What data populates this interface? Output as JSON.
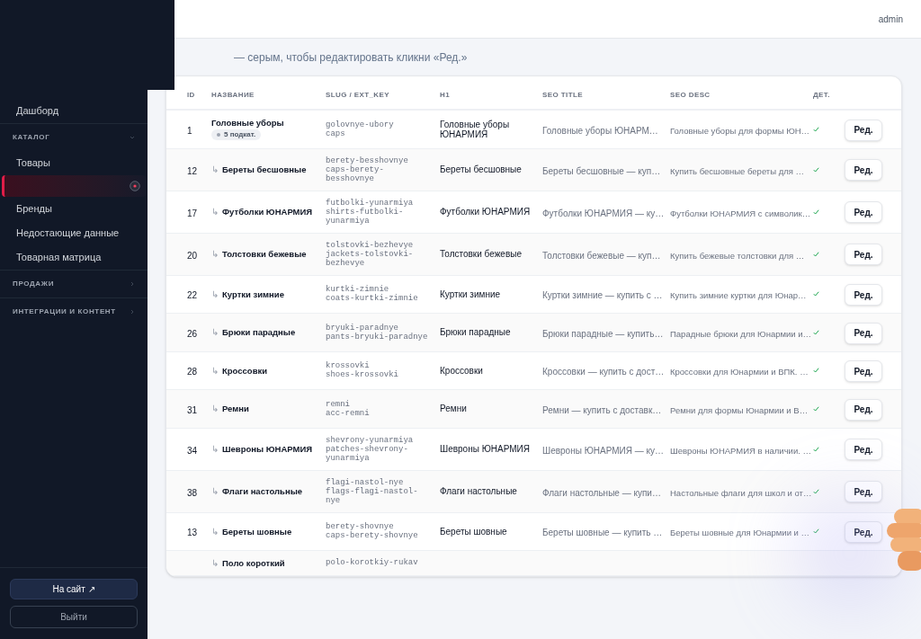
{
  "sidebar": {
    "items": [
      {
        "kind": "link",
        "label": "Дашборд",
        "selected": false
      },
      {
        "kind": "section",
        "label": "КАТАЛОГ",
        "expanded": true
      },
      {
        "kind": "link",
        "label": "Товары",
        "selected": false
      },
      {
        "kind": "link",
        "selected": true
      },
      {
        "kind": "link",
        "label": "Бренды",
        "selected": false
      },
      {
        "kind": "link",
        "label": "Недостающие данные",
        "selected": false
      },
      {
        "kind": "link",
        "label": "Товарная матрица",
        "selected": false
      },
      {
        "kind": "section",
        "label": "ПРОДАЖИ",
        "expanded": false
      },
      {
        "kind": "section",
        "label": "ИНТЕГРАЦИИ И КОНТЕНТ",
        "expanded": false
      }
    ],
    "buttons": [
      {
        "kind": "primary",
        "label": "На сайт ↗"
      },
      {
        "kind": "outline",
        "label": "Выйти"
      }
    ]
  },
  "header": {
    "user": "admin"
  },
  "notice": "— серым, чтобы редактировать кликни «Ред.»",
  "table": {
    "columns": [
      "ID",
      "НАЗВАНИЕ",
      "SLUG / EXT_KEY",
      "H1",
      "SEO TITLE",
      "SEO DESC",
      "ДЕТ."
    ],
    "rows": [
      {
        "id": "1",
        "name": "Головные уборы",
        "badge": "5 подкат.",
        "slug": "golovnye-ubory",
        "ext_key": "caps",
        "h1": "Головные уборы ЮНАРМИЯ",
        "seo_title": "Головные уборы ЮНАРМ…",
        "seo_desc": "Головные уборы для формы ЮН…",
        "details": true,
        "action": "Ред."
      },
      {
        "id": "12",
        "marker": "↳",
        "name": "Береты бесшовные",
        "slug": "berety-besshovnye",
        "ext_key": "caps-berety-besshovnye",
        "h1": "Береты бесшовные",
        "seo_title": "Береты бесшовные — куп…",
        "seo_desc": "Купить бесшовные береты для …",
        "details": true,
        "action": "Ред."
      },
      {
        "id": "17",
        "marker": "↳",
        "name": "Футболки ЮНАРМИЯ",
        "slug": "futbolki-yunarmiya",
        "ext_key": "shirts-futbolki-yunarmiya",
        "h1": "Футболки ЮНАРМИЯ",
        "seo_title": "Футболки ЮНАРМИЯ — ку…",
        "seo_desc": "Футболки ЮНАРМИЯ с символик…",
        "details": true,
        "action": "Ред."
      },
      {
        "id": "20",
        "marker": "↳",
        "name": "Толстовки бежевые",
        "slug": "tolstovki-bezhevye",
        "ext_key": "jackets-tolstovki-bezhevye",
        "h1": "Толстовки бежевые",
        "seo_title": "Толстовки бежевые — куп…",
        "seo_desc": "Купить бежевые толстовки для …",
        "details": true,
        "action": "Ред."
      },
      {
        "id": "22",
        "marker": "↳",
        "name": "Куртки зимние",
        "slug": "kurtki-zimnie",
        "ext_key": "coats-kurtki-zimnie",
        "h1": "Куртки зимние",
        "seo_title": "Куртки зимние — купить с …",
        "seo_desc": "Купить зимние куртки для Юнар…",
        "details": true,
        "action": "Ред."
      },
      {
        "id": "26",
        "marker": "↳",
        "name": "Брюки парадные",
        "slug": "bryuki-paradnye",
        "ext_key": "pants-bryuki-paradnye",
        "h1": "Брюки парадные",
        "seo_title": "Брюки парадные — купить…",
        "seo_desc": "Парадные брюки для Юнармии и…",
        "details": true,
        "action": "Ред."
      },
      {
        "id": "28",
        "marker": "↳",
        "name": "Кроссовки",
        "slug": "krossovki",
        "ext_key": "shoes-krossovki",
        "h1": "Кроссовки",
        "seo_title": "Кроссовки — купить с дост…",
        "seo_desc": "Кроссовки для Юнармии и ВПК. …",
        "details": true,
        "action": "Ред."
      },
      {
        "id": "31",
        "marker": "↳",
        "name": "Ремни",
        "slug": "remni",
        "ext_key": "acc-remni",
        "h1": "Ремни",
        "seo_title": "Ремни — купить с доставк…",
        "seo_desc": "Ремни для формы Юнармии и В…",
        "details": true,
        "action": "Ред."
      },
      {
        "id": "34",
        "marker": "↳",
        "name": "Шевроны ЮНАРМИЯ",
        "slug": "shevrony-yunarmiya",
        "ext_key": "patches-shevrony-yunarmiya",
        "h1": "Шевроны ЮНАРМИЯ",
        "seo_title": "Шевроны ЮНАРМИЯ — ку…",
        "seo_desc": "Шевроны ЮНАРМИЯ в наличии. …",
        "details": true,
        "action": "Ред."
      },
      {
        "id": "38",
        "marker": "↳",
        "name": "Флаги настольные",
        "slug": "flagi-nastol-nye",
        "ext_key": "flags-flagi-nastol-nye",
        "h1": "Флаги настольные",
        "seo_title": "Флаги настольные — купи…",
        "seo_desc": "Настольные флаги для школ и от…",
        "details": true,
        "action": "Ред."
      },
      {
        "id": "13",
        "marker": "↳",
        "name": "Береты шовные",
        "slug": "berety-shovnye",
        "ext_key": "caps-berety-shovnye",
        "h1": "Береты шовные",
        "seo_title": "Береты шовные — купить …",
        "seo_desc": "Береты шовные для Юнармии и …",
        "details": true,
        "action": "Ред."
      },
      {
        "marker": "↳",
        "name": "Поло короткий",
        "slug": "polo-korotkiy-rukav"
      }
    ]
  }
}
